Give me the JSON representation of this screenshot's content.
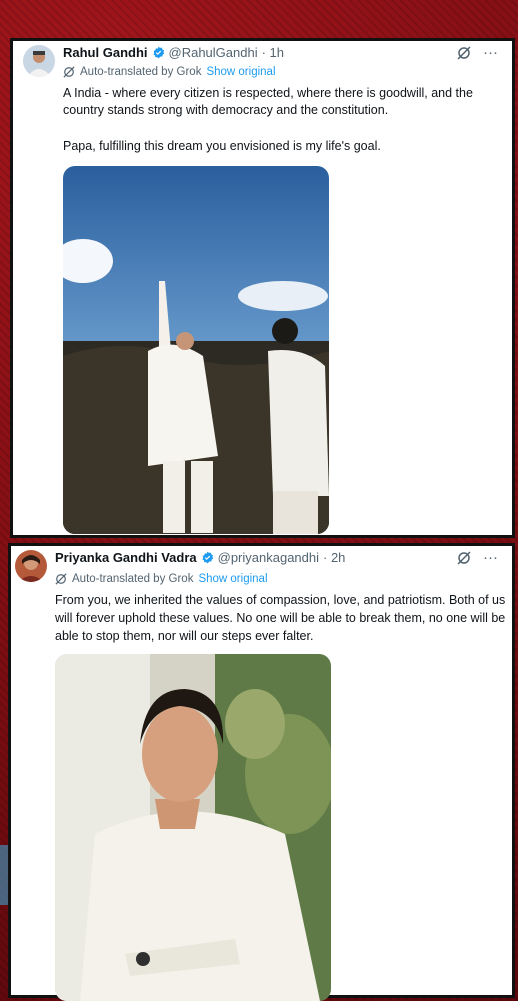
{
  "tweet1": {
    "name": "Rahul Gandhi",
    "handle": "@RahulGandhi",
    "time": "· 1h",
    "auto_translated": "Auto-translated by Grok",
    "show_original": "Show original",
    "text1": "A India - where every citizen is respected, where there is goodwill, and the country stands strong with democracy and the constitution.",
    "text2": "Papa, fulfilling this dream you envisioned is my life's goal."
  },
  "tweet2": {
    "name": "Priyanka Gandhi Vadra",
    "handle": "@priyankagandhi",
    "time": "· 2h",
    "auto_translated": "Auto-translated by Grok",
    "show_original": "Show original",
    "text": "From you, we inherited the values of compassion, love, and patriotism. Both of us will forever uphold these values. No one will be able to break them, no one will be able to stop them, nor will our steps ever falter."
  },
  "icons": {
    "verified": "verified-badge-icon",
    "grok": "grok-icon",
    "more": "more-icon"
  },
  "colors": {
    "link": "#1d9bf0",
    "muted": "#536471",
    "background": "#7a0d12"
  }
}
